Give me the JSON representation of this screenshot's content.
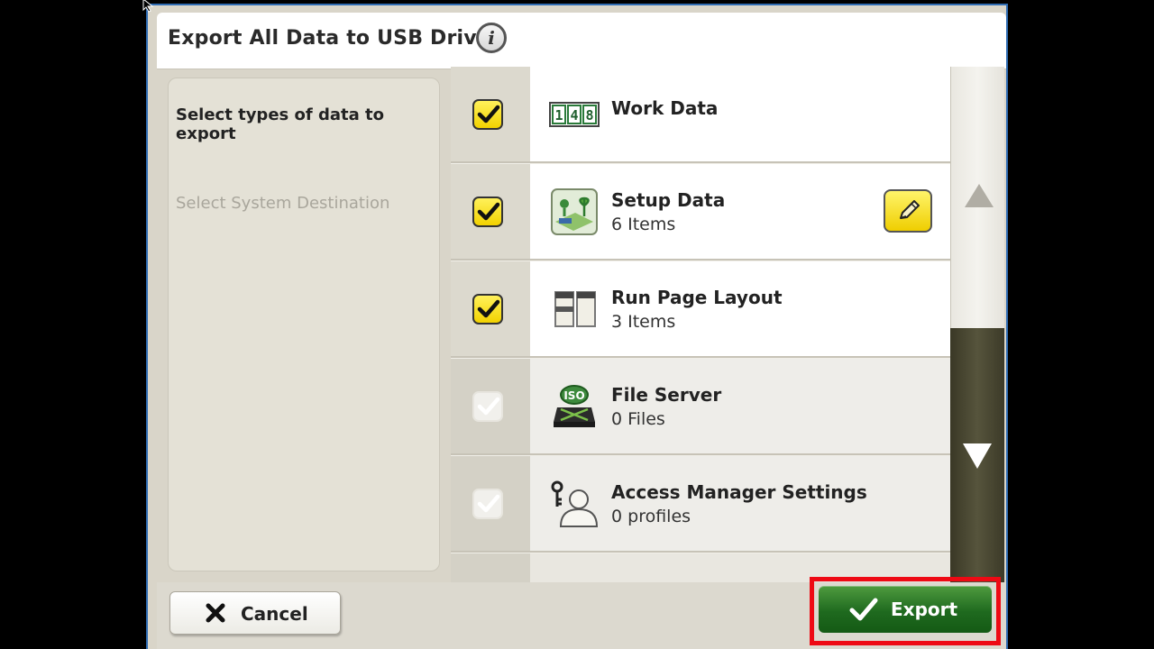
{
  "window": {
    "title": "Export All Data to USB Drive",
    "info_icon": "info-icon"
  },
  "steps": {
    "active": "Select types of data to export",
    "inactive": "Select System Destination"
  },
  "items": [
    {
      "title": "Work Data",
      "subtitle": "",
      "checked": true,
      "enabled": true,
      "icon": "work-data-counter-icon"
    },
    {
      "title": "Setup Data",
      "subtitle": "6 Items",
      "checked": true,
      "enabled": true,
      "icon": "setup-data-icon",
      "editable": true
    },
    {
      "title": "Run Page Layout",
      "subtitle": "3 Items",
      "checked": true,
      "enabled": true,
      "icon": "run-page-layout-icon"
    },
    {
      "title": "File Server",
      "subtitle": "0 Files",
      "checked": false,
      "enabled": false,
      "icon": "iso-file-server-icon"
    },
    {
      "title": "Access Manager Settings",
      "subtitle": "0 profiles",
      "checked": false,
      "enabled": false,
      "icon": "access-manager-icon"
    }
  ],
  "work_data_digits": [
    "1",
    "4",
    "8"
  ],
  "footer": {
    "cancel_label": "Cancel",
    "export_label": "Export"
  },
  "colors": {
    "accent_yellow": "#f5dc10",
    "export_green": "#1f6a1f",
    "highlight_red": "#ee0a14",
    "frame_blue": "#2f6cb3"
  }
}
